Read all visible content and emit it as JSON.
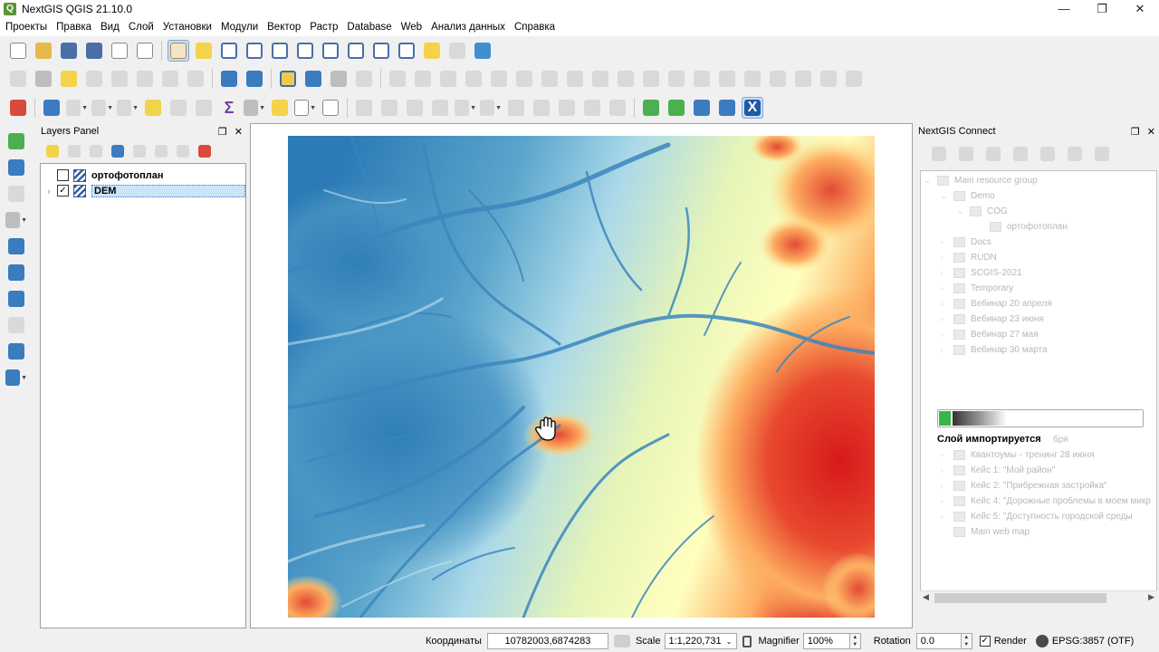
{
  "window": {
    "title": "NextGIS QGIS 21.10.0",
    "controls": [
      "—",
      "❐",
      "✕"
    ]
  },
  "menu": [
    "Проекты",
    "Правка",
    "Вид",
    "Слой",
    "Установки",
    "Модули",
    "Вектор",
    "Растр",
    "Database",
    "Web",
    "Анализ данных",
    "Справка"
  ],
  "layers_panel": {
    "title": "Layers Panel",
    "layers": [
      {
        "name": "ортофотоплан",
        "checked": false,
        "check_mark": ""
      },
      {
        "name": "DEM",
        "checked": true,
        "check_mark": "✓",
        "selected": true
      }
    ]
  },
  "ngc_panel": {
    "title": "NextGIS Connect",
    "tree": [
      {
        "label": "Main resource group",
        "depth": 0,
        "expanded": true
      },
      {
        "label": "Demo",
        "depth": 1,
        "expanded": true
      },
      {
        "label": "COG",
        "depth": 2,
        "expanded": true
      },
      {
        "label": "ортофотоплан",
        "depth": 3
      },
      {
        "label": "Docs",
        "depth": 1
      },
      {
        "label": "RUDN",
        "depth": 1
      },
      {
        "label": "SCGIS-2021",
        "depth": 1
      },
      {
        "label": "Temporary",
        "depth": 1
      },
      {
        "label": "Вебинар 20 апреля",
        "depth": 1
      },
      {
        "label": "Вебинар 23 июня",
        "depth": 1
      },
      {
        "label": "Вебинар 27 мая",
        "depth": 1
      },
      {
        "label": "Вебинар 30 марта",
        "depth": 1
      },
      {
        "label": "Квантоумы - тренинг 28 июня",
        "depth": 1
      },
      {
        "label": "Кейс 1: \"Мой район\"",
        "depth": 1
      },
      {
        "label": "Кейс 2: \"Прибрежная застройка\"",
        "depth": 1
      },
      {
        "label": "Кейс 4: \"Дорожные проблемы в моем микр",
        "depth": 1
      },
      {
        "label": "Кейс 5: \"Доступность городской среды",
        "depth": 1
      },
      {
        "label": "Main web map",
        "depth": 1
      }
    ],
    "partial_label": "бря",
    "progress": {
      "fraction": 0.06,
      "label": "Слой импортируется"
    }
  },
  "statusbar": {
    "coords_label": "Координаты",
    "coords_value": "10782003,6874283",
    "scale_label": "Scale",
    "scale_value": "1:1,220,731",
    "magnifier_label": "Magnifier",
    "magnifier_value": "100%",
    "rotation_label": "Rotation",
    "rotation_value": "0.0",
    "render_label": "Render",
    "render_checked": true,
    "render_check_mark": "✓",
    "crs_label": "EPSG:3857 (OTF)"
  },
  "colors": {
    "dem_low": "#2c7bb6",
    "dem_mid_low": "#abd9e9",
    "dem_mid": "#ffffbf",
    "dem_mid_high": "#fdae61",
    "dem_high": "#d7191c",
    "progress_fill": "#39b54a"
  }
}
